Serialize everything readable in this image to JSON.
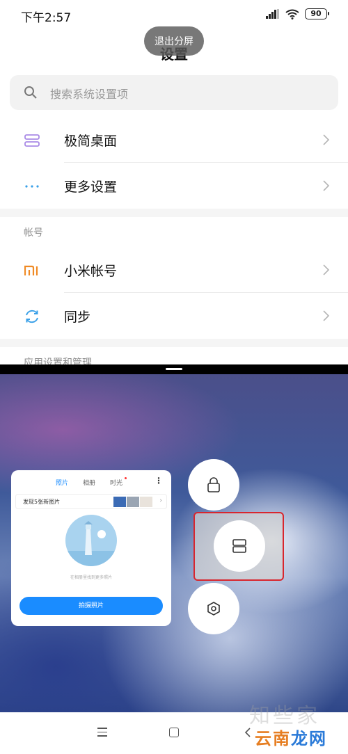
{
  "status": {
    "time": "下午2:57",
    "battery": "90"
  },
  "header": {
    "title": "设置",
    "exit_split_label": "退出分屏"
  },
  "search": {
    "placeholder": "搜索系统设置项"
  },
  "settings_rows_1": [
    {
      "label": "极简桌面",
      "icon": "minimal-desktop-icon",
      "icon_color": "#a98be6"
    },
    {
      "label": "更多设置",
      "icon": "more-dots-icon",
      "icon_color": "#3aa0e8"
    }
  ],
  "section_account": {
    "title": "帐号"
  },
  "settings_rows_2": [
    {
      "label": "小米帐号",
      "icon": "mi-logo-icon",
      "icon_color": "#f08a24"
    },
    {
      "label": "同步",
      "icon": "sync-icon",
      "icon_color": "#3aa0e8"
    }
  ],
  "section_apps": {
    "title": "应用设置和管理"
  },
  "recent_card": {
    "tabs": [
      "照片",
      "相册",
      "时光"
    ],
    "active_tab": "照片",
    "banner_text": "发现5张新图片",
    "caption": "在相册里找到更多照片",
    "cta": "拍摄照片"
  },
  "actions": [
    {
      "name": "lock-icon"
    },
    {
      "name": "split-screen-icon"
    },
    {
      "name": "settings-hexagon-icon"
    }
  ],
  "colors": {
    "accent": "#1a8cff",
    "highlight": "#d8262e"
  },
  "watermark": {
    "text": "知些家",
    "logo_a": "云南",
    "logo_b": "龙网"
  }
}
